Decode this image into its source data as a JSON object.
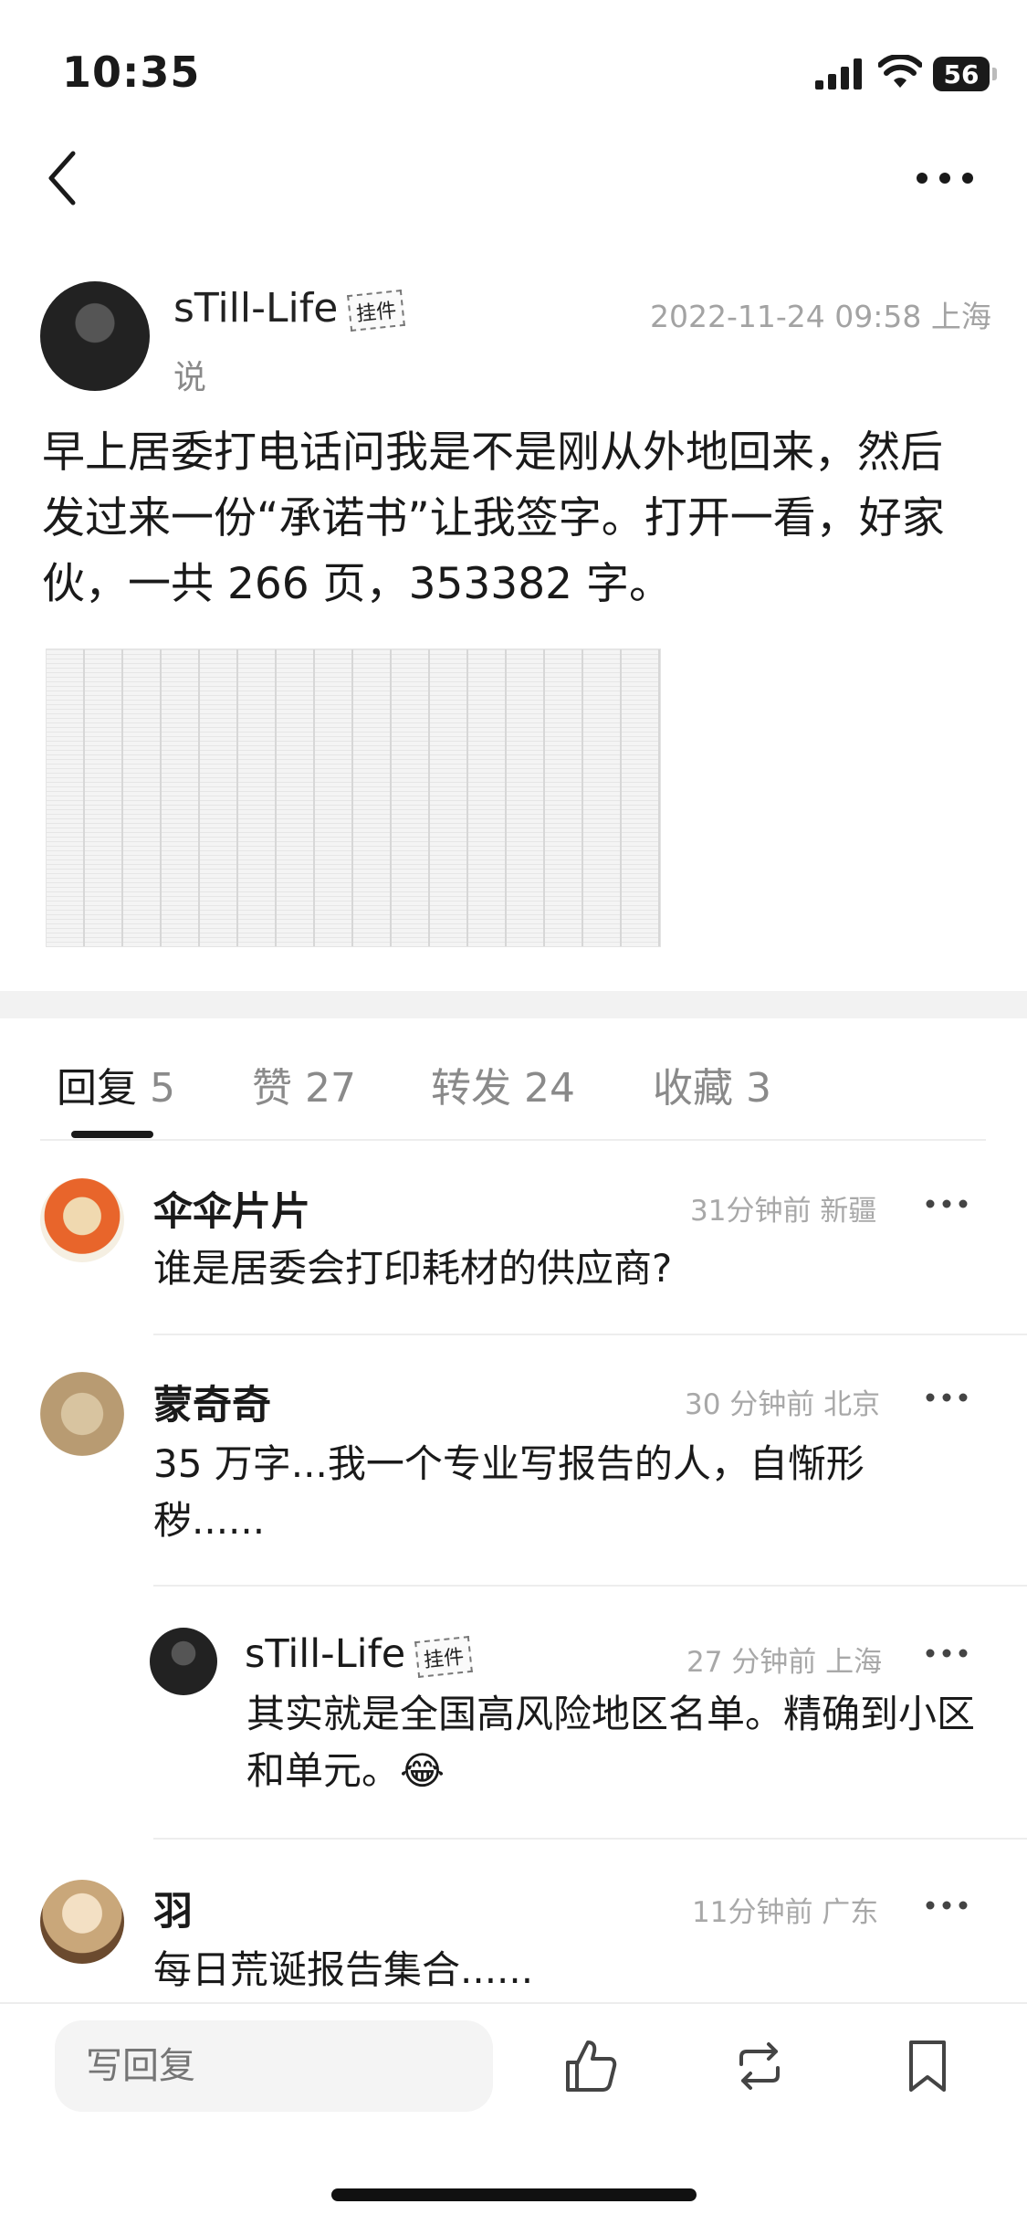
{
  "status_bar": {
    "time": "10:35",
    "battery": "56"
  },
  "post": {
    "author": "sTill-Life",
    "pendant_label": "挂件",
    "said": "说",
    "datetime": "2022-11-24 09:58 上海",
    "text": "早上居委打电话问我是不是刚从外地回来，然后发过来一份“承诺书”让我签字。打开一看，好家伙，一共 266 页，353382 字。"
  },
  "tabs": [
    {
      "label": "回复",
      "count": "5"
    },
    {
      "label": "赞",
      "count": "27"
    },
    {
      "label": "转发",
      "count": "24"
    },
    {
      "label": "收藏",
      "count": "3"
    }
  ],
  "comments": [
    {
      "name": "伞伞片片",
      "meta": "31分钟前 新疆",
      "text": "谁是居委会打印耗材的供应商?"
    },
    {
      "name": "蒙奇奇",
      "meta": "30 分钟前 北京",
      "text": "35 万字...我一个专业写报告的人，自惭形秽......"
    },
    {
      "name": "sTill-Life",
      "pendant_label": "挂件",
      "meta": "27 分钟前 上海",
      "text": "其实就是全国高风险地区名单。精确到小区和单元。😂"
    },
    {
      "name": "羽",
      "meta": "11分钟前 广东",
      "text": "每日荒诞报告集合......"
    }
  ],
  "bottom_bar": {
    "reply_placeholder": "写回复"
  }
}
